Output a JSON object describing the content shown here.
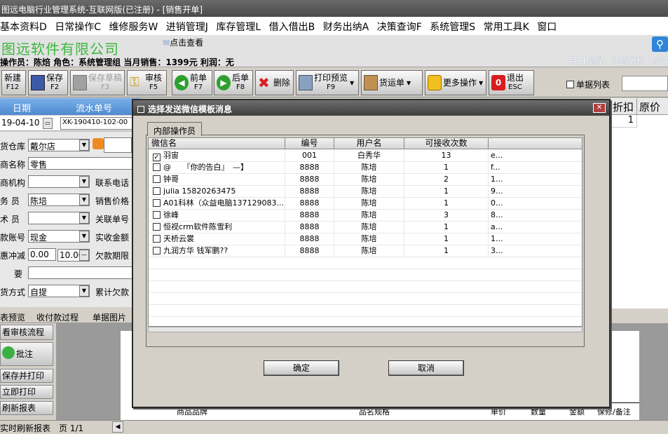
{
  "window": {
    "title": "图远电脑行业管理系统-互联网版(已注册) - [销售开单]"
  },
  "menu": {
    "items": [
      "基本资料D",
      "日常操作C",
      "维修服务W",
      "进销管理J",
      "库存管理L",
      "借入借出B",
      "财务出纳A",
      "决策查询F",
      "系统管理S",
      "常用工具K",
      "窗口"
    ]
  },
  "banner": {
    "company": "图远软件有限公司",
    "click_view": "点击查看",
    "operator_info": "操作员：陈焙  角色：系统管理组  当月销售：1399元  利润：无",
    "links": [
      "每日提醒",
      "经营历程",
      "应收"
    ],
    "search_icon": "magnifier"
  },
  "toolbar": {
    "buttons": [
      {
        "label": "新建",
        "key": "F12",
        "icon": "new-doc",
        "enabled": true
      },
      {
        "label": "保存",
        "key": "F2",
        "icon": "floppy",
        "enabled": true
      },
      {
        "label": "保存草稿",
        "key": "F3",
        "icon": "floppy",
        "enabled": false
      },
      {
        "label": "审核",
        "key": "F5",
        "icon": "key",
        "enabled": true
      },
      {
        "label": "前单",
        "key": "F7",
        "icon": "arrow-left",
        "enabled": true
      },
      {
        "label": "后单",
        "key": "F8",
        "icon": "arrow-right",
        "enabled": true
      },
      {
        "label": "删除",
        "key": "",
        "icon": "red-x",
        "enabled": true
      },
      {
        "label": "打印预览",
        "key": "F9",
        "icon": "printer",
        "enabled": true
      },
      {
        "label": "货运单",
        "key": "",
        "icon": "truck",
        "enabled": true
      },
      {
        "label": "更多操作",
        "key": "",
        "icon": "folder",
        "enabled": true
      },
      {
        "label": "退出",
        "key": "ESC",
        "icon": "exit",
        "enabled": true
      }
    ],
    "list_toggle": "单据列表"
  },
  "form": {
    "grid_headers": [
      "日期",
      "流水单号"
    ],
    "date": "19-04-10",
    "serial": "XK-190410-102-00",
    "labels": [
      "货仓库",
      "商名称",
      "商机构",
      "务 员",
      "术 员",
      "款账号",
      "惠冲减",
      "要",
      "货方式"
    ],
    "warehouse": "戴尔店",
    "customer": "零售",
    "salesman": "陈培",
    "account": "现金",
    "discount": "0.00",
    "discount2": "10.00",
    "delivery": "自提",
    "right_labels": [
      "联系电话",
      "销售价格",
      "关联单号",
      "实收金额",
      "欠款期限",
      "累计欠款"
    ]
  },
  "right_grid": {
    "headers": [
      "折扣",
      "原价"
    ],
    "first_value": "1"
  },
  "bottom_tabs": [
    "表预览",
    "收付款过程",
    "单据图片"
  ],
  "side_buttons": [
    "看审核流程",
    "批注",
    "保存并打印",
    "立即打印",
    "刷新报表",
    "实时刷新报表"
  ],
  "preview": {
    "headers": [
      "商品品牌",
      "品名规格",
      "单价",
      "数量",
      "金额",
      "保修/备注"
    ]
  },
  "status": {
    "page": "页 1/1"
  },
  "dialog": {
    "title": "选择发送微信模板消息",
    "tab": "内部操作员",
    "columns": [
      "微信名",
      "编号",
      "用户名",
      "可接收次数"
    ],
    "rows": [
      {
        "checked": true,
        "wechat": "羽宙",
        "code": "001",
        "user": "白秀华",
        "count": "13",
        "extra": "e..."
      },
      {
        "checked": false,
        "wechat": "@　　『你的告白』　—】",
        "code": "8888",
        "user": "陈培",
        "count": "1",
        "extra": "f..."
      },
      {
        "checked": false,
        "wechat": "钟哥",
        "code": "8888",
        "user": "陈培",
        "count": "2",
        "extra": "1..."
      },
      {
        "checked": false,
        "wechat": "julia 15820263475",
        "code": "8888",
        "user": "陈培",
        "count": "1",
        "extra": "9..."
      },
      {
        "checked": false,
        "wechat": "A01科林（众益电脑137129083...",
        "code": "8888",
        "user": "陈培",
        "count": "1",
        "extra": "0..."
      },
      {
        "checked": false,
        "wechat": "徐峰",
        "code": "8888",
        "user": "陈培",
        "count": "3",
        "extra": "8..."
      },
      {
        "checked": false,
        "wechat": "恒视crm软件陈雪利",
        "code": "8888",
        "user": "陈培",
        "count": "1",
        "extra": "a..."
      },
      {
        "checked": false,
        "wechat": "天桥云裳",
        "code": "8888",
        "user": "陈培",
        "count": "1",
        "extra": "1..."
      },
      {
        "checked": false,
        "wechat": "九润方华 钱军鹏??",
        "code": "8888",
        "user": "陈培",
        "count": "1",
        "extra": "3..."
      }
    ],
    "ok": "确定",
    "cancel": "取消"
  }
}
